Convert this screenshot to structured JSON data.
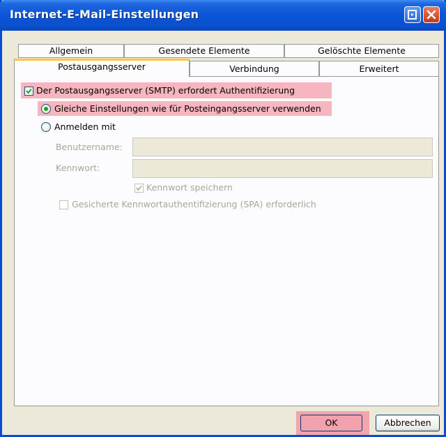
{
  "window": {
    "title": "Internet-E-Mail-Einstellungen"
  },
  "tabs": {
    "row1": [
      "Allgemein",
      "Gesendete Elemente",
      "Gelöschte Elemente"
    ],
    "row2": [
      "Postausgangsserver",
      "Verbindung",
      "Erweitert"
    ],
    "active": "Postausgangsserver"
  },
  "smtp": {
    "auth_required_label": "Der Postausgangsserver (SMTP) erfordert Authentifizierung",
    "auth_required_checked": true,
    "same_settings_label": "Gleiche Einstellungen wie für Posteingangsserver verwenden",
    "same_settings_selected": true,
    "login_with_label": "Anmelden mit",
    "login_with_selected": false,
    "username_label": "Benutzername:",
    "username_value": "",
    "password_label": "Kennwort:",
    "password_value": "",
    "remember_password_label": "Kennwort speichern",
    "remember_password_checked": true,
    "spa_label": "Gesicherte Kennwortauthentifizierung (SPA) erforderlich",
    "spa_checked": false
  },
  "buttons": {
    "ok": "OK",
    "cancel": "Abbrechen"
  },
  "colors": {
    "titlebar": "#0A55D8",
    "highlight": "#F7B6BF",
    "active_tab_accent": "#FFC83C"
  },
  "icons": {
    "help": "help-window-icon",
    "close": "close-icon",
    "check": "checkmark-icon"
  }
}
